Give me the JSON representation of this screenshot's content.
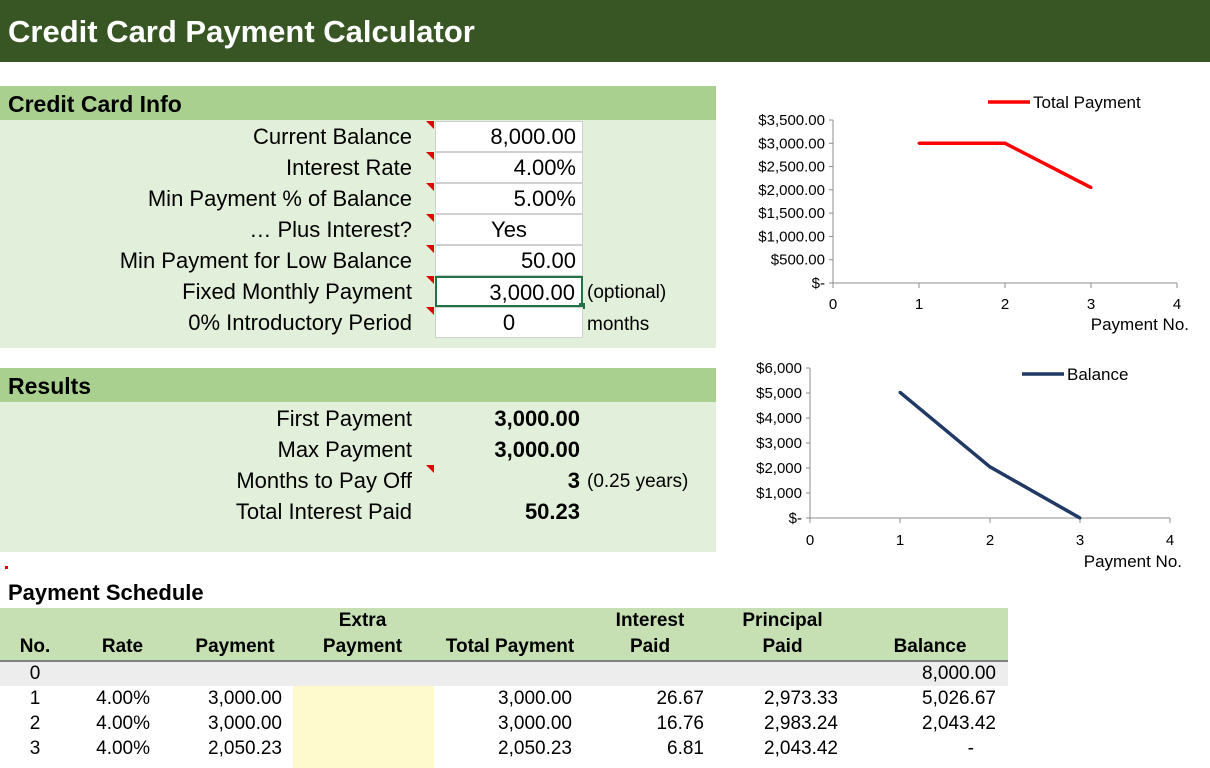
{
  "title": "Credit Card Payment Calculator",
  "info": {
    "heading": "Credit Card Info",
    "current_balance_label": "Current Balance",
    "current_balance": "8,000.00",
    "interest_rate_label": "Interest Rate",
    "interest_rate": "4.00%",
    "min_pct_label": "Min Payment % of Balance",
    "min_pct": "5.00%",
    "plus_interest_label": "… Plus Interest?",
    "plus_interest": "Yes",
    "min_low_label": "Min Payment for Low Balance",
    "min_low": "50.00",
    "fixed_label": "Fixed Monthly Payment",
    "fixed": "3,000.00",
    "fixed_note": "(optional)",
    "intro_label": "0% Introductory Period",
    "intro": "0",
    "intro_note": "months"
  },
  "results": {
    "heading": "Results",
    "first_label": "First Payment",
    "first": "3,000.00",
    "max_label": "Max Payment",
    "max": "3,000.00",
    "months_label": "Months to Pay Off",
    "months": "3",
    "months_note": "(0.25 years)",
    "interest_label": "Total Interest Paid",
    "interest": "50.23"
  },
  "schedule": {
    "title": "Payment Schedule",
    "headers": {
      "no": "No.",
      "rate": "Rate",
      "payment": "Payment",
      "extra_1": "Extra",
      "extra_2": "Payment",
      "total": "Total Payment",
      "interest_1": "Interest",
      "interest_2": "Paid",
      "principal_1": "Principal",
      "principal_2": "Paid",
      "balance": "Balance"
    },
    "rows": [
      {
        "no": "0",
        "rate": "",
        "payment": "",
        "extra": "",
        "total": "",
        "interest": "",
        "principal": "",
        "balance": "8,000.00"
      },
      {
        "no": "1",
        "rate": "4.00%",
        "payment": "3,000.00",
        "extra": "",
        "total": "3,000.00",
        "interest": "26.67",
        "principal": "2,973.33",
        "balance": "5,026.67"
      },
      {
        "no": "2",
        "rate": "4.00%",
        "payment": "3,000.00",
        "extra": "",
        "total": "3,000.00",
        "interest": "16.76",
        "principal": "2,983.24",
        "balance": "2,043.42"
      },
      {
        "no": "3",
        "rate": "4.00%",
        "payment": "2,050.23",
        "extra": "",
        "total": "2,050.23",
        "interest": "6.81",
        "principal": "2,043.42",
        "balance": "-"
      }
    ]
  },
  "chart_data": [
    {
      "type": "line",
      "legend": "Total Payment",
      "legend_position": "top-right",
      "color": "#ff0000",
      "x": [
        1,
        2,
        3
      ],
      "y": [
        3000,
        3000,
        2050.23
      ],
      "xlim": [
        0,
        4
      ],
      "ylim": [
        0,
        3500
      ],
      "xticks": [
        "0",
        "1",
        "2",
        "3",
        "4"
      ],
      "yticks": [
        "$-",
        "$500.00",
        "$1,000.00",
        "$1,500.00",
        "$2,000.00",
        "$2,500.00",
        "$3,000.00",
        "$3,500.00"
      ],
      "xlabel": "Payment No.",
      "ylabel": "",
      "grid": false
    },
    {
      "type": "line",
      "legend": "Balance",
      "legend_position": "top-right",
      "color": "#1f3864",
      "x": [
        1,
        2,
        3
      ],
      "y": [
        5026.67,
        2043.42,
        0
      ],
      "xlim": [
        0,
        4
      ],
      "ylim": [
        0,
        6000
      ],
      "xticks": [
        "0",
        "1",
        "2",
        "3",
        "4"
      ],
      "yticks": [
        "$-",
        "$1,000",
        "$2,000",
        "$3,000",
        "$4,000",
        "$5,000",
        "$6,000"
      ],
      "xlabel": "Payment No.",
      "ylabel": "",
      "grid": false
    }
  ]
}
